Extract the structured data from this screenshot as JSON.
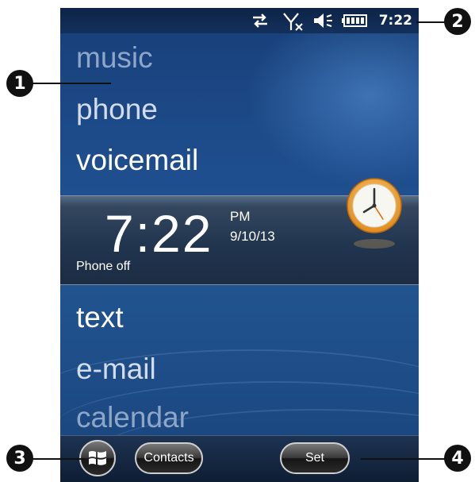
{
  "status_bar": {
    "time": "7:22",
    "icons": [
      "data-sync-icon",
      "no-signal-icon",
      "speaker-muted-icon",
      "battery-full-icon"
    ]
  },
  "menu": {
    "top_items": [
      {
        "label": "music",
        "state": "faded"
      },
      {
        "label": "phone",
        "state": "dim"
      },
      {
        "label": "voicemail",
        "state": "active"
      }
    ],
    "bottom_items": [
      {
        "label": "text",
        "state": "active"
      },
      {
        "label": "e-mail",
        "state": "dim"
      },
      {
        "label": "calendar",
        "state": "faded"
      }
    ]
  },
  "clock": {
    "time": "7:22",
    "ampm": "PM",
    "date": "9/10/13",
    "status": "Phone off",
    "icon": "clock-icon"
  },
  "softkeys": {
    "start_icon": "windows-start-icon",
    "left": "Contacts",
    "right": "Set"
  },
  "callouts": [
    "1",
    "2",
    "3",
    "4"
  ],
  "colors": {
    "background_top": "#173f78",
    "background_bottom": "#1a447c",
    "text_active": "#ffffff",
    "text_dim": "#d2dcea",
    "text_faded": "#8ea6c8",
    "clock_accent": "#f2a033"
  }
}
